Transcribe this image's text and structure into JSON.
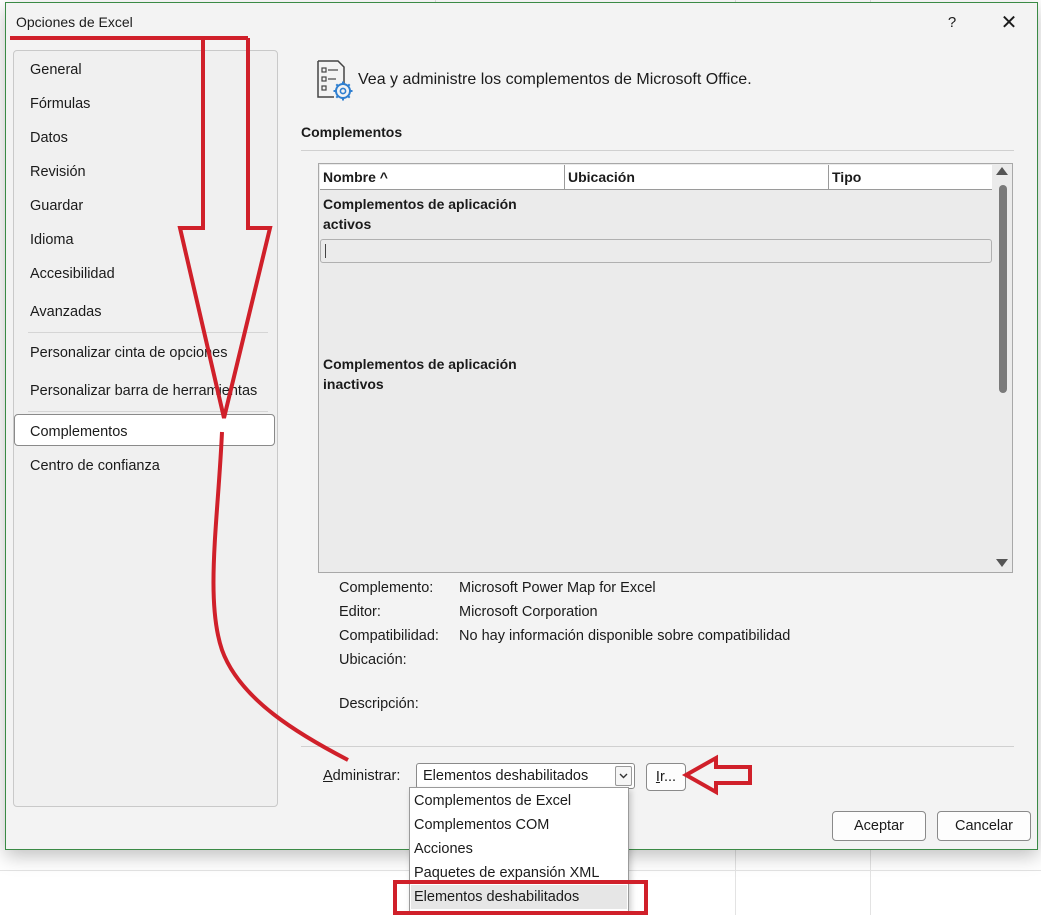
{
  "window": {
    "title": "Opciones de Excel",
    "help_label": "?",
    "close_label": "✕"
  },
  "nav": {
    "items": [
      {
        "label": "General"
      },
      {
        "label": "Fórmulas"
      },
      {
        "label": "Datos"
      },
      {
        "label": "Revisión"
      },
      {
        "label": "Guardar"
      },
      {
        "label": "Idioma"
      },
      {
        "label": "Accesibilidad"
      },
      {
        "label": "Avanzadas"
      },
      {
        "label": "Personalizar cinta de opciones"
      },
      {
        "label": "Personalizar barra de herramientas"
      },
      {
        "label": "Complementos",
        "selected": true
      },
      {
        "label": "Centro de confianza"
      }
    ]
  },
  "header": {
    "icon": "addins-settings-icon",
    "text": "Vea y administre los complementos de Microsoft Office."
  },
  "section": {
    "title": "Complementos"
  },
  "addins_table": {
    "columns": [
      "Nombre ^",
      "Ubicación",
      "Tipo"
    ],
    "groups": [
      {
        "label_line1": "Complementos de aplicación",
        "label_line2": "activos"
      },
      {
        "label_line1": "Complementos de aplicación",
        "label_line2": "inactivos"
      }
    ]
  },
  "details": {
    "addin_label": "Complemento:",
    "addin_value": "Microsoft Power Map for Excel",
    "publisher_label": "Editor:",
    "publisher_value": "Microsoft Corporation",
    "compat_label": "Compatibilidad:",
    "compat_value": "No hay información disponible sobre compatibilidad",
    "location_label": "Ubicación:",
    "location_value": "",
    "description_label": "Descripción:"
  },
  "manage": {
    "label_underlined": "A",
    "label_rest": "dministrar:",
    "selected_value": "Elementos deshabilitados",
    "go_underlined": "I",
    "go_rest": "r...",
    "options": [
      "Complementos de Excel",
      "Complementos COM",
      "Acciones",
      "Paquetes de expansión XML",
      "Elementos deshabilitados"
    ]
  },
  "buttons": {
    "ok": "Aceptar",
    "cancel": "Cancelar"
  },
  "colors": {
    "annotation": "#d0202a",
    "dialog_border": "#3a8a45"
  }
}
